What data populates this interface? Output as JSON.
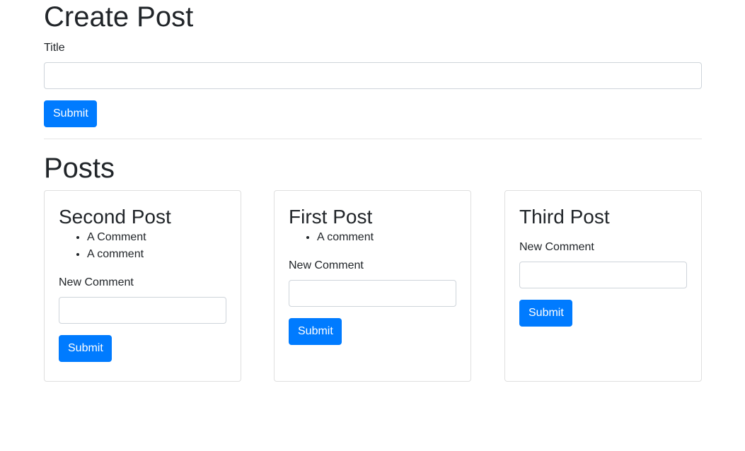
{
  "create": {
    "heading": "Create Post",
    "title_label": "Title",
    "title_value": "",
    "submit_label": "Submit"
  },
  "posts": {
    "heading": "Posts",
    "items": [
      {
        "title": "Second Post",
        "comments": [
          "A Comment",
          "A comment"
        ],
        "new_comment_label": "New Comment",
        "new_comment_value": "",
        "submit_label": "Submit"
      },
      {
        "title": "First Post",
        "comments": [
          "A comment"
        ],
        "new_comment_label": "New Comment",
        "new_comment_value": "",
        "submit_label": "Submit"
      },
      {
        "title": "Third Post",
        "comments": [],
        "new_comment_label": "New Comment",
        "new_comment_value": "",
        "submit_label": "Submit"
      }
    ]
  },
  "colors": {
    "primary": "#007bff",
    "border": "#dfdfdf",
    "text": "#212529"
  }
}
